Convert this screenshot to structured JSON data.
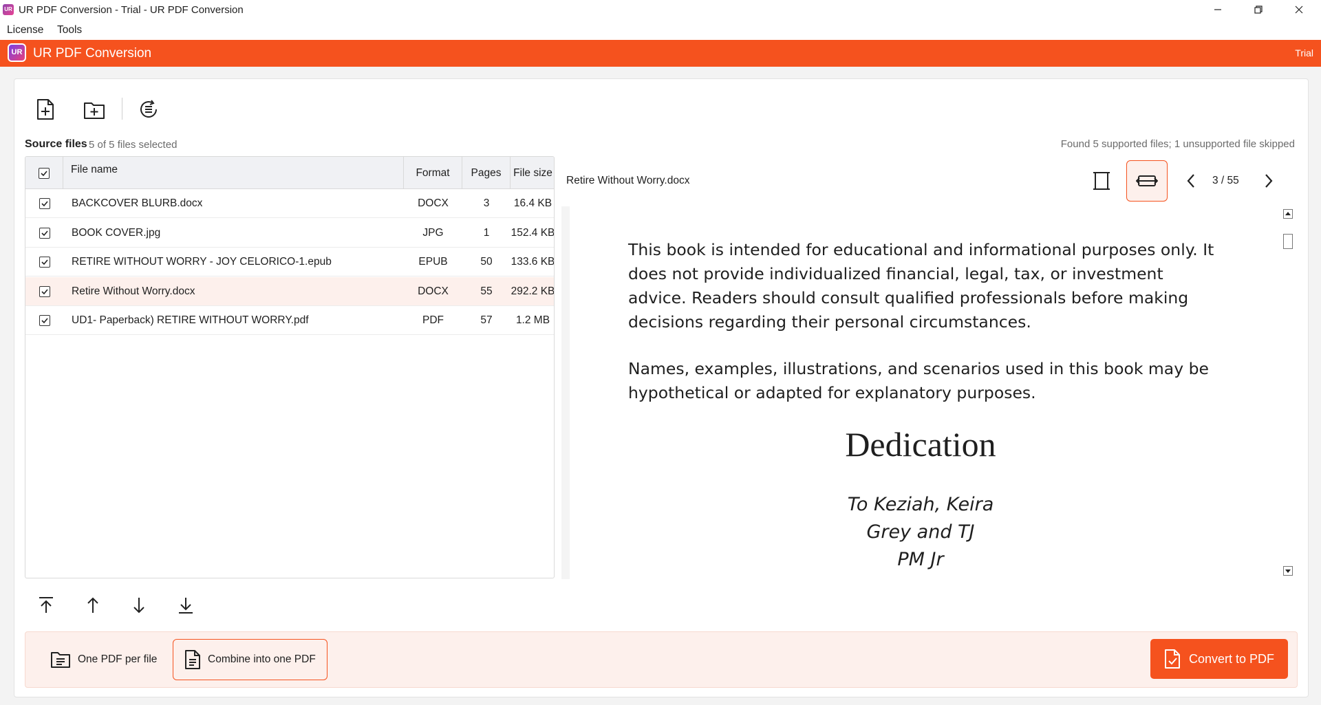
{
  "window": {
    "title": "UR PDF Conversion - Trial - UR PDF Conversion",
    "icon_text": "UR"
  },
  "menu": {
    "license": "License",
    "tools": "Tools"
  },
  "header": {
    "logo_text": "UR",
    "app_name": "UR PDF Conversion",
    "badge": "Trial"
  },
  "toolbar": {
    "icons": [
      "add-file-icon",
      "add-folder-icon",
      "clear-list-icon"
    ]
  },
  "source": {
    "label": "Source files",
    "count": "5 of 5 files selected",
    "found_message": "Found 5 supported files; 1 unsupported file skipped"
  },
  "table": {
    "headers": {
      "name": "File name",
      "format": "Format",
      "pages": "Pages",
      "size": "File size"
    },
    "rows": [
      {
        "name": "BACKCOVER BLURB.docx",
        "format": "DOCX",
        "pages": "3",
        "size": "16.4 KB",
        "checked": true,
        "selected": false
      },
      {
        "name": "BOOK COVER.jpg",
        "format": "JPG",
        "pages": "1",
        "size": "152.4 KB",
        "checked": true,
        "selected": false
      },
      {
        "name": "RETIRE WITHOUT WORRY - JOY CELORICO-1.epub",
        "format": "EPUB",
        "pages": "50",
        "size": "133.6 KB",
        "checked": true,
        "selected": false
      },
      {
        "name": "Retire Without Worry.docx",
        "format": "DOCX",
        "pages": "55",
        "size": "292.2 KB",
        "checked": true,
        "selected": true
      },
      {
        "name": "UD1- Paperback) RETIRE WITHOUT WORRY.pdf",
        "format": "PDF",
        "pages": "57",
        "size": "1.2 MB",
        "checked": true,
        "selected": false
      }
    ]
  },
  "preview": {
    "file_name": "Retire Without Worry.docx",
    "page_indicator": "3 / 55",
    "paragraph1": "This book is intended for educational and informational purposes only. It does not provide individualized financial, legal, tax, or investment advice. Readers should consult qualified professionals before making decisions regarding their personal circumstances.",
    "paragraph2": "Names, examples, illustrations, and scenarios used in this book may be hypothetical or adapted for explanatory purposes.",
    "dedication_title": "Dedication",
    "dedication_line1": "To Keziah, Keira",
    "dedication_line2": "Grey and TJ",
    "dedication_line3": "PM Jr"
  },
  "bottom": {
    "one_pdf": "One PDF per file",
    "combine": "Combine into one PDF",
    "convert": "Convert to PDF",
    "mode_selected": "combine"
  },
  "colors": {
    "accent": "#f5521e",
    "accent_light": "#fdf0ec",
    "selected_row": "#fdf0ec"
  }
}
